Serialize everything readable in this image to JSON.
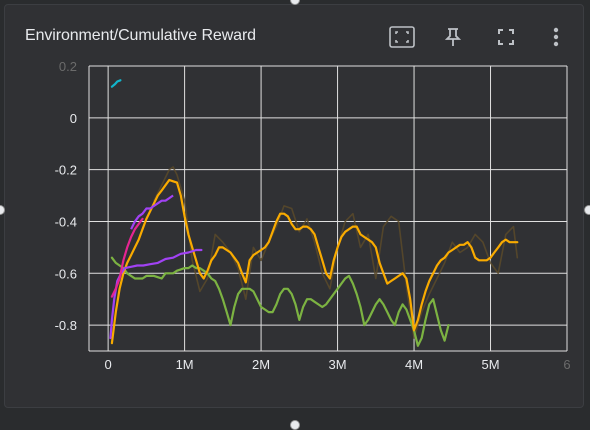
{
  "card": {
    "title": "Environment/Cumulative Reward"
  },
  "toolbar": {
    "fit_domain_icon": "fit-to-domain-icon",
    "pin_icon": "pin-icon",
    "fullscreen_icon": "fullscreen-icon",
    "more_icon": "more-vert-icon"
  },
  "chart_data": {
    "type": "line",
    "title": "Environment/Cumulative Reward",
    "xlabel": "",
    "ylabel": "",
    "xlim": [
      -0.25,
      6.0
    ],
    "ylim": [
      -0.9,
      0.2
    ],
    "x_ticks": [
      "0",
      "1M",
      "2M",
      "3M",
      "4M",
      "5M",
      "6"
    ],
    "y_ticks": [
      "0.2",
      "0",
      "-0.2",
      "-0.4",
      "-0.6",
      "-0.8"
    ],
    "grid": true,
    "series": [
      {
        "color": "#12b5cb",
        "x": [
          0.05,
          0.09,
          0.12,
          0.16
        ],
        "y": [
          0.12,
          0.13,
          0.14,
          0.145
        ]
      },
      {
        "color": "#e52592",
        "x": [
          0.05,
          0.1,
          0.15,
          0.2,
          0.25,
          0.3,
          0.35,
          0.4,
          0.45
        ],
        "y": [
          -0.69,
          -0.66,
          -0.62,
          -0.55,
          -0.5,
          -0.46,
          -0.43,
          -0.41,
          -0.39
        ]
      },
      {
        "color": "#a142f4",
        "x": [
          0.03,
          0.05,
          0.08,
          0.12,
          0.17,
          0.22,
          0.3,
          0.38,
          0.46,
          0.55,
          0.65,
          0.75,
          0.85,
          0.95,
          1.05,
          1.15,
          1.22
        ],
        "y": [
          -0.85,
          -0.78,
          -0.7,
          -0.63,
          -0.6,
          -0.58,
          -0.575,
          -0.57,
          -0.57,
          -0.565,
          -0.56,
          -0.545,
          -0.54,
          -0.525,
          -0.52,
          -0.51,
          -0.51
        ],
        "x2": [
          0.3,
          0.35,
          0.4,
          0.45,
          0.5,
          0.55,
          0.6,
          0.65,
          0.7,
          0.75,
          0.8,
          0.85
        ],
        "y2": [
          -0.43,
          -0.4,
          -0.38,
          -0.37,
          -0.35,
          -0.35,
          -0.34,
          -0.33,
          -0.32,
          -0.32,
          -0.31,
          -0.3
        ]
      },
      {
        "color": "#f9ab00",
        "x": [
          0.05,
          0.1,
          0.15,
          0.2,
          0.25,
          0.3,
          0.35,
          0.4,
          0.45,
          0.5,
          0.55,
          0.6,
          0.65,
          0.7,
          0.75,
          0.8,
          0.85,
          0.9,
          0.95,
          1.0,
          1.05,
          1.1,
          1.15,
          1.2,
          1.25,
          1.3,
          1.35,
          1.4,
          1.45,
          1.5,
          1.55,
          1.6,
          1.65,
          1.7,
          1.75,
          1.8,
          1.85,
          1.9,
          1.95,
          2.0,
          2.05,
          2.1,
          2.15,
          2.2,
          2.25,
          2.3,
          2.35,
          2.4,
          2.45,
          2.5,
          2.55,
          2.6,
          2.65,
          2.7,
          2.75,
          2.8,
          2.85,
          2.9,
          2.95,
          3.0,
          3.05,
          3.1,
          3.15,
          3.2,
          3.25,
          3.3,
          3.35,
          3.4,
          3.45,
          3.5,
          3.55,
          3.6,
          3.65,
          3.7,
          3.75,
          3.8,
          3.85,
          3.9,
          3.95,
          4.0,
          4.05,
          4.1,
          4.15,
          4.2,
          4.25,
          4.3,
          4.35,
          4.4,
          4.45,
          4.5,
          4.55,
          4.6,
          4.65,
          4.7,
          4.75,
          4.8,
          4.85,
          4.9,
          4.95,
          5.0,
          5.05,
          5.1,
          5.15,
          5.2,
          5.25,
          5.3,
          5.35
        ],
        "y": [
          -0.87,
          -0.75,
          -0.66,
          -0.6,
          -0.56,
          -0.53,
          -0.5,
          -0.47,
          -0.43,
          -0.39,
          -0.36,
          -0.33,
          -0.3,
          -0.28,
          -0.26,
          -0.24,
          -0.245,
          -0.25,
          -0.3,
          -0.38,
          -0.45,
          -0.5,
          -0.55,
          -0.6,
          -0.62,
          -0.59,
          -0.55,
          -0.53,
          -0.5,
          -0.5,
          -0.51,
          -0.52,
          -0.54,
          -0.56,
          -0.6,
          -0.635,
          -0.55,
          -0.53,
          -0.52,
          -0.51,
          -0.5,
          -0.48,
          -0.44,
          -0.4,
          -0.37,
          -0.37,
          -0.38,
          -0.41,
          -0.43,
          -0.43,
          -0.42,
          -0.42,
          -0.43,
          -0.45,
          -0.5,
          -0.55,
          -0.6,
          -0.62,
          -0.55,
          -0.5,
          -0.46,
          -0.44,
          -0.43,
          -0.42,
          -0.42,
          -0.45,
          -0.46,
          -0.47,
          -0.48,
          -0.5,
          -0.56,
          -0.6,
          -0.64,
          -0.63,
          -0.62,
          -0.61,
          -0.6,
          -0.62,
          -0.7,
          -0.82,
          -0.78,
          -0.72,
          -0.67,
          -0.63,
          -0.6,
          -0.57,
          -0.55,
          -0.54,
          -0.52,
          -0.51,
          -0.5,
          -0.49,
          -0.49,
          -0.48,
          -0.5,
          -0.54,
          -0.55,
          -0.55,
          -0.55,
          -0.54,
          -0.52,
          -0.5,
          -0.48,
          -0.47,
          -0.48,
          -0.48,
          -0.48
        ]
      },
      {
        "color": "#7cb342",
        "x": [
          0.05,
          0.1,
          0.15,
          0.2,
          0.25,
          0.3,
          0.35,
          0.4,
          0.45,
          0.5,
          0.55,
          0.6,
          0.65,
          0.7,
          0.75,
          0.8,
          0.85,
          0.9,
          0.95,
          1.0,
          1.05,
          1.1,
          1.15,
          1.2,
          1.25,
          1.3,
          1.35,
          1.4,
          1.45,
          1.5,
          1.55,
          1.6,
          1.65,
          1.7,
          1.75,
          1.8,
          1.85,
          1.9,
          1.95,
          2.0,
          2.05,
          2.1,
          2.15,
          2.2,
          2.25,
          2.3,
          2.35,
          2.4,
          2.45,
          2.5,
          2.55,
          2.6,
          2.65,
          2.7,
          2.75,
          2.8,
          2.85,
          2.9,
          2.95,
          3.0,
          3.05,
          3.1,
          3.15,
          3.2,
          3.25,
          3.3,
          3.35,
          3.4,
          3.45,
          3.5,
          3.55,
          3.6,
          3.65,
          3.7,
          3.75,
          3.8,
          3.85,
          3.9,
          3.95,
          4.0,
          4.05,
          4.1,
          4.15,
          4.2,
          4.25,
          4.3,
          4.35,
          4.4,
          4.45
        ],
        "y": [
          -0.54,
          -0.56,
          -0.57,
          -0.58,
          -0.6,
          -0.61,
          -0.62,
          -0.62,
          -0.62,
          -0.61,
          -0.61,
          -0.61,
          -0.615,
          -0.62,
          -0.6,
          -0.6,
          -0.6,
          -0.59,
          -0.585,
          -0.58,
          -0.58,
          -0.57,
          -0.58,
          -0.58,
          -0.59,
          -0.6,
          -0.62,
          -0.63,
          -0.66,
          -0.7,
          -0.75,
          -0.8,
          -0.73,
          -0.68,
          -0.66,
          -0.66,
          -0.66,
          -0.67,
          -0.7,
          -0.73,
          -0.74,
          -0.75,
          -0.75,
          -0.72,
          -0.68,
          -0.66,
          -0.66,
          -0.68,
          -0.72,
          -0.78,
          -0.73,
          -0.7,
          -0.7,
          -0.71,
          -0.72,
          -0.73,
          -0.72,
          -0.7,
          -0.68,
          -0.66,
          -0.64,
          -0.62,
          -0.61,
          -0.64,
          -0.68,
          -0.73,
          -0.8,
          -0.78,
          -0.75,
          -0.72,
          -0.7,
          -0.72,
          -0.75,
          -0.78,
          -0.8,
          -0.75,
          -0.72,
          -0.74,
          -0.78,
          -0.82,
          -0.88,
          -0.85,
          -0.78,
          -0.72,
          -0.7,
          -0.76,
          -0.82,
          -0.86,
          -0.8
        ]
      },
      {
        "color": "#5a4a2a",
        "x": [
          0.6,
          0.7,
          0.8,
          0.85,
          0.9,
          1.0,
          1.1,
          1.2,
          1.3,
          1.4,
          1.5,
          1.6,
          1.7,
          1.8,
          1.9,
          2.0,
          2.1,
          2.2,
          2.3,
          2.4,
          2.5,
          2.6,
          2.7,
          2.8,
          2.9,
          3.0,
          3.1,
          3.2,
          3.3,
          3.4,
          3.5,
          3.6,
          3.7,
          3.8,
          3.9,
          4.0,
          4.1,
          4.2,
          4.3,
          4.4,
          4.5,
          4.6,
          4.7,
          4.8,
          4.9,
          5.0,
          5.1,
          5.2,
          5.3,
          5.35
        ],
        "y": [
          -0.32,
          -0.26,
          -0.2,
          -0.19,
          -0.22,
          -0.32,
          -0.55,
          -0.67,
          -0.62,
          -0.45,
          -0.48,
          -0.52,
          -0.58,
          -0.7,
          -0.5,
          -0.55,
          -0.48,
          -0.42,
          -0.34,
          -0.35,
          -0.44,
          -0.39,
          -0.48,
          -0.6,
          -0.66,
          -0.5,
          -0.4,
          -0.37,
          -0.5,
          -0.45,
          -0.62,
          -0.42,
          -0.38,
          -0.4,
          -0.65,
          -0.85,
          -0.75,
          -0.68,
          -0.62,
          -0.56,
          -0.48,
          -0.52,
          -0.5,
          -0.45,
          -0.48,
          -0.56,
          -0.6,
          -0.45,
          -0.42,
          -0.54
        ]
      }
    ]
  }
}
